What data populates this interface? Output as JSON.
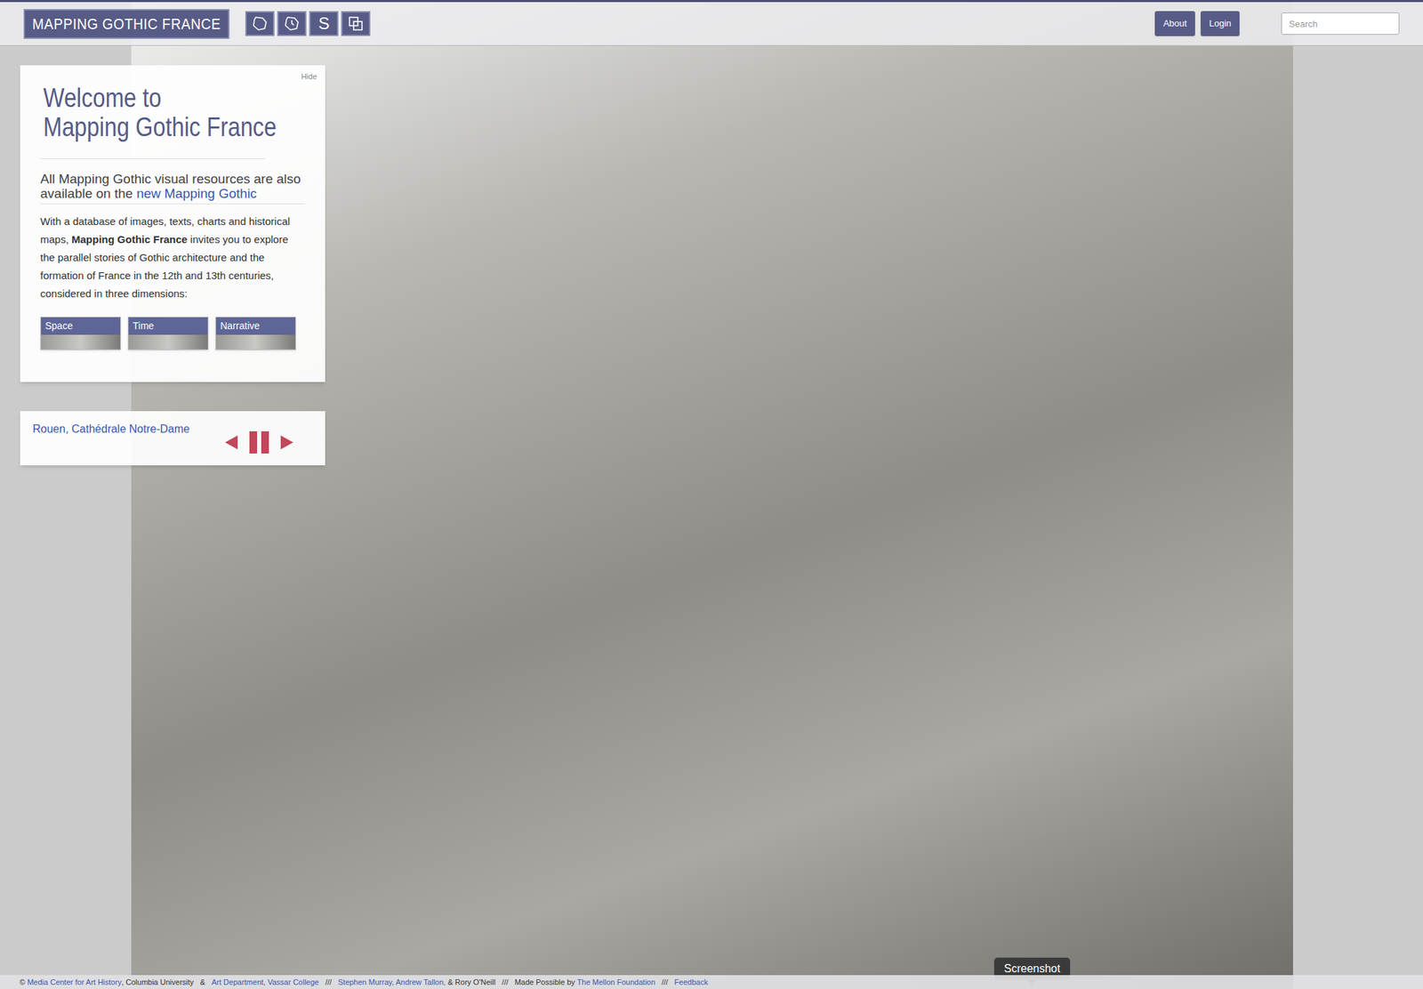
{
  "header": {
    "logo": "MAPPING GOTHIC FRANCE",
    "nav_buttons": [
      {
        "kind": "map"
      },
      {
        "kind": "time-map"
      },
      {
        "kind": "text",
        "label": "S"
      },
      {
        "kind": "compare"
      }
    ],
    "buttons": [
      "About",
      "Login"
    ],
    "search": {
      "placeholder": "Search"
    }
  },
  "welcome": {
    "hide": "Hide",
    "title_lines": [
      "Welcome to",
      "Mapping Gothic France"
    ],
    "notice": {
      "text": "All Mapping Gothic visual resources are also available on the ",
      "link": "new Mapping Gothic"
    },
    "body": [
      {
        "text": "With a database of images, texts, charts and historical maps, ",
        "bold": false
      },
      {
        "text": "Mapping Gothic France",
        "bold": true
      },
      {
        "text": " invites you to explore the parallel stories of Gothic architecture and the formation of France in the 12th and 13th centuries, considered in three dimensions:",
        "bold": false
      }
    ],
    "dimensions": [
      {
        "label": "Space",
        "selected": false
      },
      {
        "label": "Time",
        "selected": false
      },
      {
        "label": "Narrative",
        "selected": false
      }
    ]
  },
  "slideshow": {
    "caption": "Rouen, Cathédrale Notre-Dame",
    "playing": true
  },
  "footer": [
    {
      "text": "© ",
      "link": false
    },
    {
      "text": "Media Center for Art History",
      "link": true
    },
    {
      "text": ", Columbia University   &   ",
      "link": false
    },
    {
      "text": "Art Department, Vassar College",
      "link": true
    },
    {
      "text": "   ///   ",
      "link": false
    },
    {
      "text": "Stephen Murray, Andrew Tallon,",
      "link": true
    },
    {
      "text": " & Rory O'Neill   ///   Made Possible by ",
      "link": false
    },
    {
      "text": "The Mellon Foundation",
      "link": true
    },
    {
      "text": "   ///   ",
      "link": false
    },
    {
      "text": "Feedback",
      "link": true
    }
  ],
  "tooltip": "Screenshot"
}
